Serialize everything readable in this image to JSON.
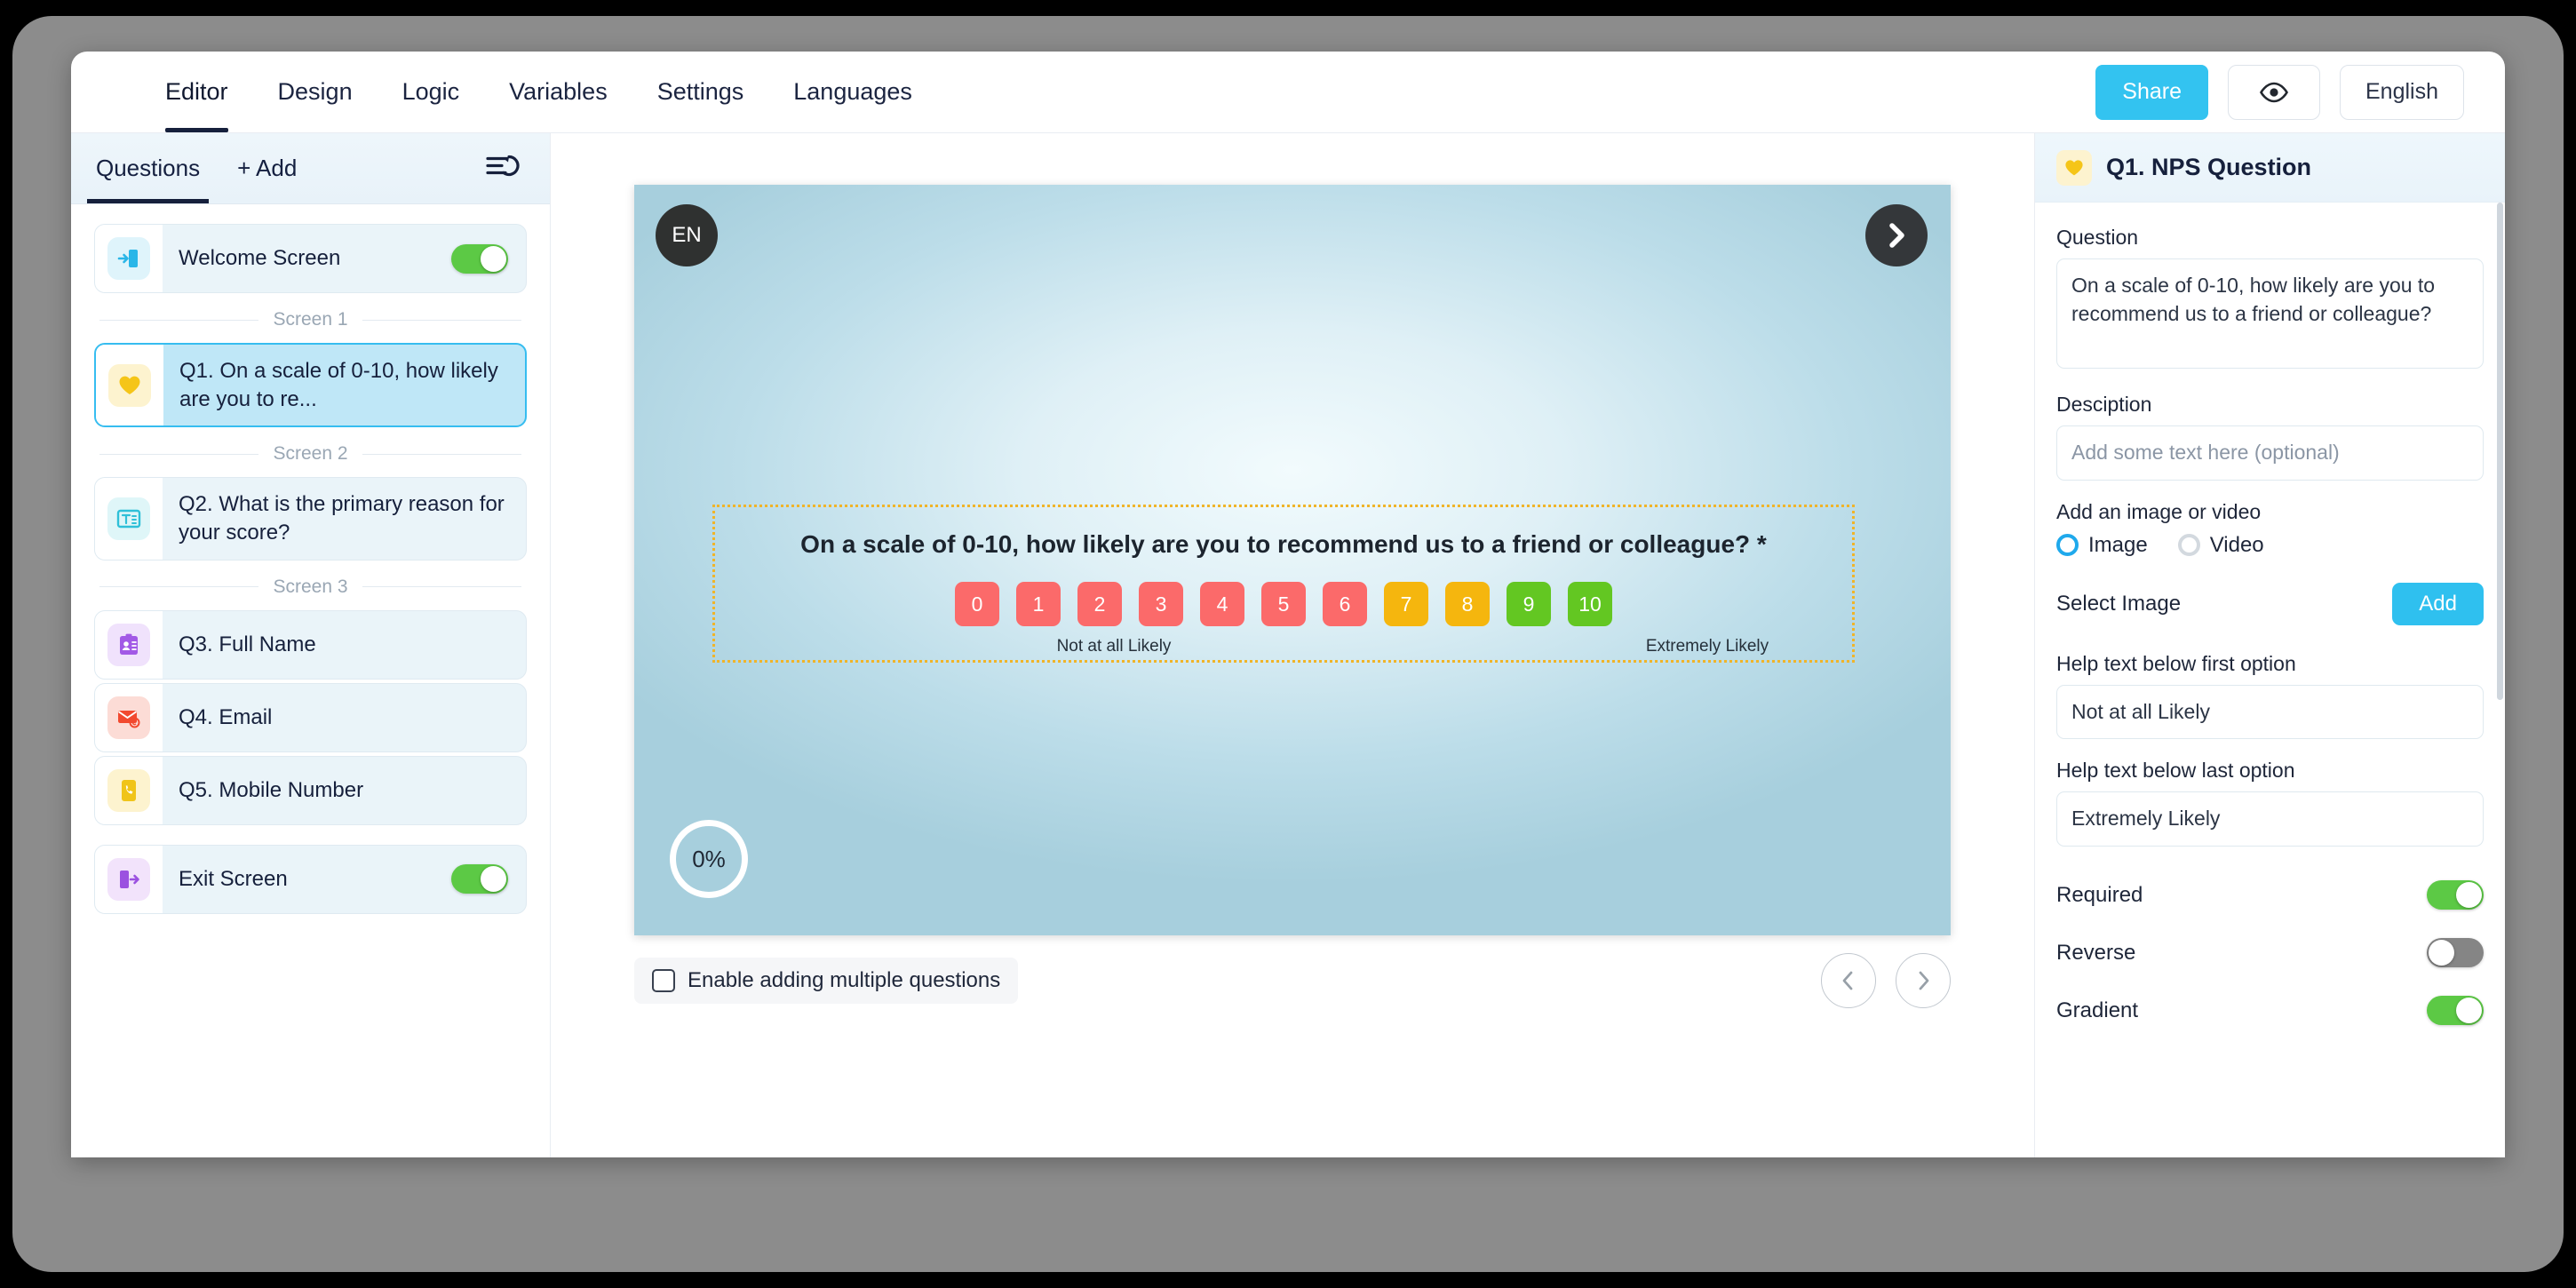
{
  "topnav": {
    "tabs": [
      {
        "label": "Editor",
        "active": true
      },
      {
        "label": "Design",
        "active": false
      },
      {
        "label": "Logic",
        "active": false
      },
      {
        "label": "Variables",
        "active": false
      },
      {
        "label": "Settings",
        "active": false
      },
      {
        "label": "Languages",
        "active": false
      }
    ],
    "share_label": "Share",
    "preview_icon": "eye-icon",
    "language_label": "English"
  },
  "sidebar": {
    "tab_questions": "Questions",
    "add_label": "+ Add",
    "reorder_icon": "reorder-undo-icon",
    "items": [
      {
        "type": "screen",
        "label": "Welcome Screen",
        "icon": "enter-door-icon",
        "icon_color": "#29b6e8",
        "icon_bg": "#dff4fb",
        "toggle": "on",
        "selected": false
      },
      {
        "type": "separator",
        "label": "Screen 1"
      },
      {
        "type": "question",
        "label": "Q1. On a scale of 0-10, how likely are you to re...",
        "icon": "heart-icon",
        "icon_color": "#f5c518",
        "icon_bg": "#fdf3cf",
        "selected": true
      },
      {
        "type": "separator",
        "label": "Screen 2"
      },
      {
        "type": "question",
        "label": "Q2. What is the primary reason for your score?",
        "icon": "text-field-icon",
        "icon_color": "#2fc0d8",
        "icon_bg": "#dff6f8",
        "selected": false
      },
      {
        "type": "separator",
        "label": "Screen 3"
      },
      {
        "type": "question",
        "label": "Q3. Full Name",
        "icon": "id-card-icon",
        "icon_color": "#a259e6",
        "icon_bg": "#f0e2fc",
        "selected": false
      },
      {
        "type": "question",
        "label": "Q4. Email",
        "icon": "envelope-icon",
        "icon_color": "#f2492f",
        "icon_bg": "#fcdcd6",
        "selected": false
      },
      {
        "type": "question",
        "label": "Q5. Mobile Number",
        "icon": "mobile-phone-icon",
        "icon_color": "#f0c419",
        "icon_bg": "#fdf3cf",
        "selected": false
      },
      {
        "type": "screen",
        "label": "Exit Screen",
        "icon": "exit-door-icon",
        "icon_color": "#9b51e0",
        "icon_bg": "#f2e3fb",
        "toggle": "on",
        "selected": false
      }
    ]
  },
  "canvas": {
    "language_badge": "EN",
    "next_icon": "chevron-right-icon",
    "progress_label": "0%",
    "question_title": "On a scale of 0-10, how likely are you to recommend us to a friend or colleague? *",
    "scale": [
      {
        "value": "0",
        "color": "#fb6a6a"
      },
      {
        "value": "1",
        "color": "#fb6a6a"
      },
      {
        "value": "2",
        "color": "#fb6a6a"
      },
      {
        "value": "3",
        "color": "#fb6a6a"
      },
      {
        "value": "4",
        "color": "#fb6a6a"
      },
      {
        "value": "5",
        "color": "#fb6a6a"
      },
      {
        "value": "6",
        "color": "#fb6a6a"
      },
      {
        "value": "7",
        "color": "#f5b60e"
      },
      {
        "value": "8",
        "color": "#f5b60e"
      },
      {
        "value": "9",
        "color": "#63c722"
      },
      {
        "value": "10",
        "color": "#63c722"
      }
    ],
    "help_first": "Not at all Likely",
    "help_last": "Extremely Likely",
    "multi_checkbox_label": "Enable adding multiple questions",
    "multi_checkbox_checked": false,
    "prev_icon": "chevron-left-icon",
    "next_nav_icon": "chevron-right-icon"
  },
  "rpanel": {
    "icon": "heart-icon",
    "title": "Q1. NPS Question",
    "question_label": "Question",
    "question_value": "On a scale of 0-10, how likely are you to recommend us to a friend or colleague?",
    "description_label": "Desciption",
    "description_placeholder": "Add some text here (optional)",
    "media_label": "Add an image or video",
    "radio_image": "Image",
    "radio_video": "Video",
    "media_selected": "Image",
    "select_image_label": "Select Image",
    "add_button": "Add",
    "help_first_label": "Help text below first option",
    "help_first_value": "Not at all Likely",
    "help_last_label": "Help text below last option",
    "help_last_value": "Extremely Likely",
    "toggles": [
      {
        "label": "Required",
        "state": "on"
      },
      {
        "label": "Reverse",
        "state": "off"
      },
      {
        "label": "Gradient",
        "state": "on"
      }
    ]
  },
  "colors": {
    "accent": "#33c3f0",
    "toggle_on": "#5cc945",
    "toggle_off": "#858585",
    "selected_row": "#bfe7f7",
    "dotted_border": "#f0b429"
  }
}
